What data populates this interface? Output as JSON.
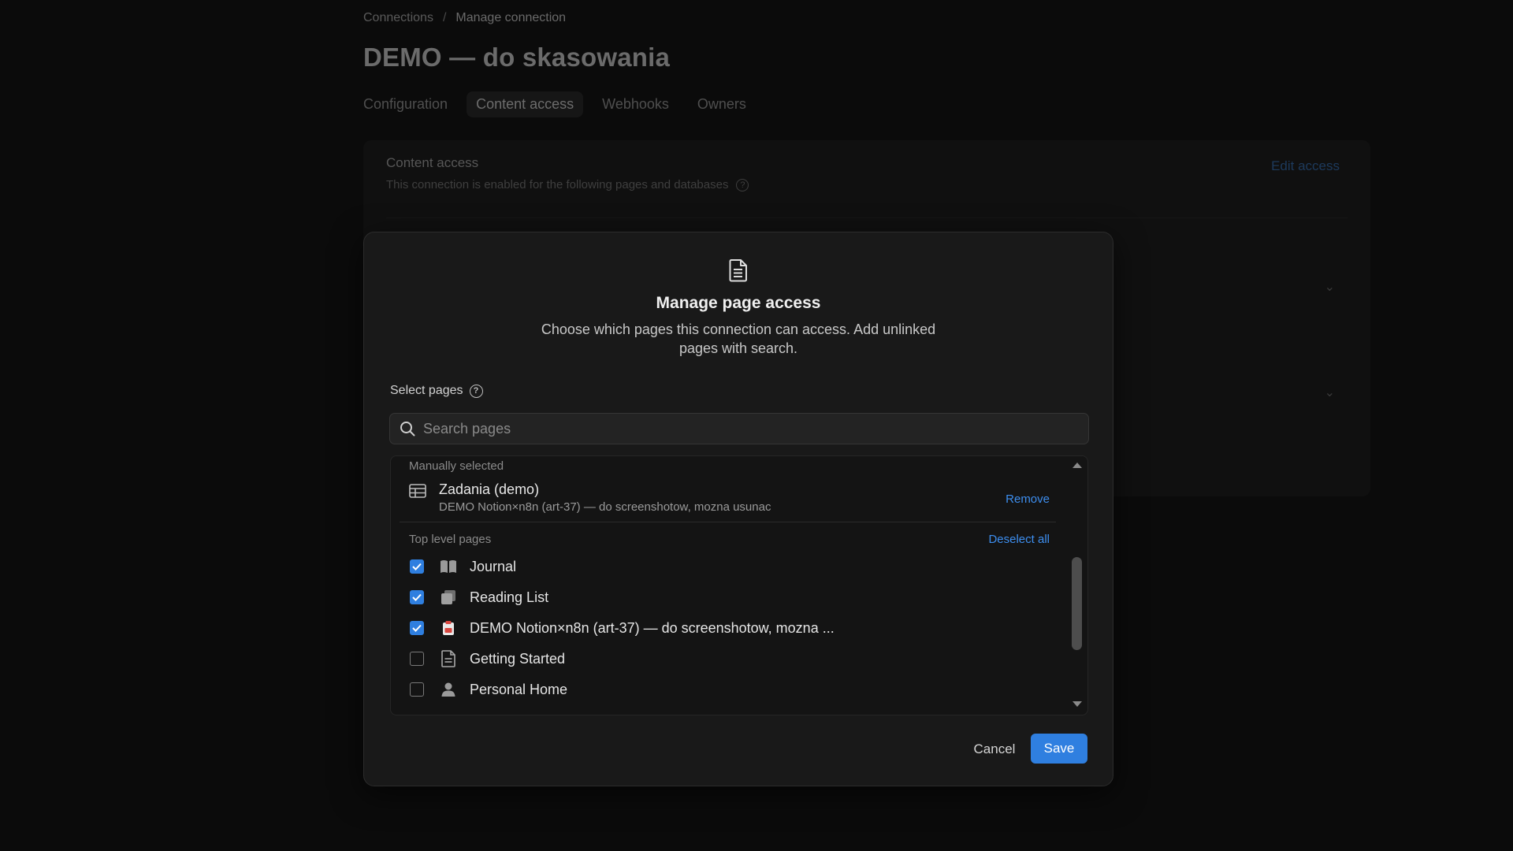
{
  "background": {
    "breadcrumb": {
      "parent": "Connections",
      "separator": "/",
      "current": "Manage connection"
    },
    "title": "DEMO — do skasowania",
    "tabs": [
      {
        "label": "Configuration",
        "active": false
      },
      {
        "label": "Content access",
        "active": true
      },
      {
        "label": "Webhooks",
        "active": false
      },
      {
        "label": "Owners",
        "active": false
      }
    ],
    "card": {
      "title": "Content access",
      "subtitle": "This connection is enabled for the following pages and databases",
      "edit_label": "Edit access"
    }
  },
  "modal": {
    "icon": "document-icon",
    "title": "Manage page access",
    "description": "Choose which pages this connection can access. Add unlinked pages with search.",
    "select_label": "Select pages",
    "search": {
      "placeholder": "Search pages",
      "value": ""
    },
    "manually_selected": {
      "header": "Manually selected",
      "item": {
        "icon": "table-icon",
        "title": "Zadania (demo)",
        "subtitle": "DEMO Notion×n8n (art-37) — do screenshotow, mozna usunac",
        "remove_label": "Remove"
      }
    },
    "top_level": {
      "header": "Top level pages",
      "deselect_label": "Deselect all",
      "pages": [
        {
          "label": "Journal",
          "icon": "book-icon",
          "checked": true
        },
        {
          "label": "Reading List",
          "icon": "stack-icon",
          "checked": true
        },
        {
          "label": "DEMO Notion×n8n (art-37) — do screenshotow, mozna ...",
          "icon": "clipboard-icon",
          "checked": true
        },
        {
          "label": "Getting Started",
          "icon": "page-icon",
          "checked": false
        },
        {
          "label": "Personal Home",
          "icon": "person-icon",
          "checked": false
        }
      ]
    },
    "actions": {
      "cancel": "Cancel",
      "save": "Save"
    }
  },
  "colors": {
    "accent": "#2f7fe0",
    "link": "#3d8eef",
    "modal_bg": "#191919",
    "page_bg": "#0b0b0b"
  }
}
